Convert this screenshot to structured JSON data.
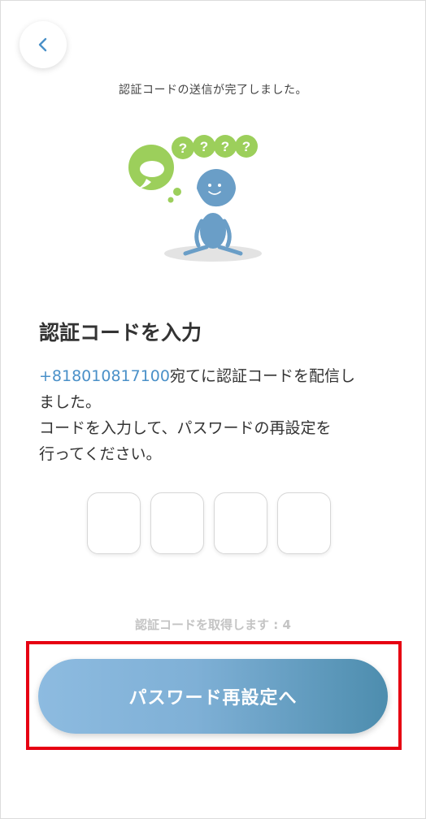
{
  "header": {
    "back_icon": "chevron-left-icon",
    "toast_message": "認証コードの送信が完了しました。"
  },
  "illustration": {
    "bubble_marks": [
      "?",
      "?",
      "?",
      "?"
    ]
  },
  "main": {
    "title": "認証コードを入力",
    "phone_number": "+818010817100",
    "desc_line1_rest": "宛てに認証コードを配信し",
    "desc_line2": "ました。",
    "desc_line3": "コードを入力して、パスワードの再設定を",
    "desc_line4": "行ってください。"
  },
  "code_inputs": [
    "",
    "",
    "",
    ""
  ],
  "resend": {
    "text": "認証コードを取得します : 4"
  },
  "submit": {
    "label": "パスワード再設定へ"
  },
  "colors": {
    "accent": "#4a90c8",
    "button_start": "#8dbbe0",
    "button_end": "#4d8dae",
    "highlight": "#e60012",
    "character": "#6a9ec7",
    "bubble": "#9ccf5b"
  }
}
